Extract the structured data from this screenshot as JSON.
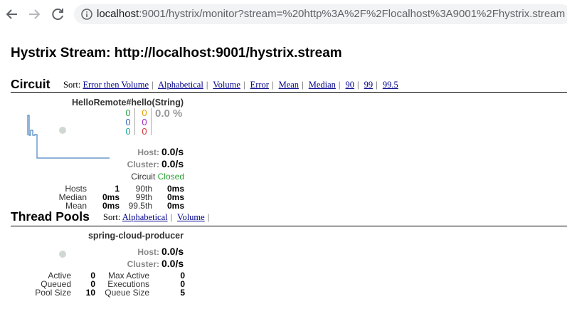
{
  "browser": {
    "url_host": "localhost",
    "url_rest": ":9001/hystrix/monitor?stream=%20http%3A%2F%2Flocalhost%3A9001%2Fhystrix.stream"
  },
  "page": {
    "title": "Hystrix Stream: http://localhost:9001/hystrix.stream"
  },
  "circuit_section": {
    "heading": "Circuit",
    "sort_label": "Sort:",
    "sort_options": [
      "Error then Volume",
      "Alphabetical",
      "Volume",
      "Error",
      "Mean",
      "Median",
      "90",
      "99",
      "99.5"
    ],
    "card": {
      "name": "HelloRemote#hello(String)",
      "counts": {
        "success": "0",
        "short_circuited": "0",
        "bad_request": "0",
        "timeout": "0",
        "rejected": "0",
        "failure": "0"
      },
      "error_pct": "0.0 %",
      "host_label": "Host:",
      "host_rate": "0.0/s",
      "cluster_label": "Cluster:",
      "cluster_rate": "0.0/s",
      "circuit_label": "Circuit",
      "circuit_status": "Closed",
      "stats": {
        "hosts_label": "Hosts",
        "hosts": "1",
        "median_label": "Median",
        "median": "0ms",
        "mean_label": "Mean",
        "mean": "0ms",
        "p90_label": "90th",
        "p90": "0ms",
        "p99_label": "99th",
        "p99": "0ms",
        "p995_label": "99.5th",
        "p995": "0ms"
      }
    }
  },
  "thread_pools_section": {
    "heading": "Thread Pools",
    "sort_label": "Sort:",
    "sort_options": [
      "Alphabetical",
      "Volume"
    ],
    "card": {
      "name": "spring-cloud-producer",
      "host_label": "Host:",
      "host_rate": "0.0/s",
      "cluster_label": "Cluster:",
      "cluster_rate": "0.0/s",
      "stats": {
        "active_label": "Active",
        "active": "0",
        "queued_label": "Queued",
        "queued": "0",
        "pool_size_label": "Pool Size",
        "pool_size": "10",
        "max_active_label": "Max Active",
        "max_active": "0",
        "executions_label": "Executions",
        "executions": "0",
        "queue_size_label": "Queue Size",
        "queue_size": "5"
      }
    }
  },
  "colors": {
    "link": "#00008b",
    "success": "#2a9d4a",
    "short_circuited": "#3a68b5",
    "bad_request": "#17a89a",
    "timeout": "#e5a100",
    "rejected": "#9a33b8",
    "failure": "#d03a3a",
    "closed": "#26a02f",
    "sparkline": "#4c84c2"
  },
  "icons": [
    "back-arrow-icon",
    "forward-arrow-icon",
    "reload-icon",
    "info-icon"
  ]
}
